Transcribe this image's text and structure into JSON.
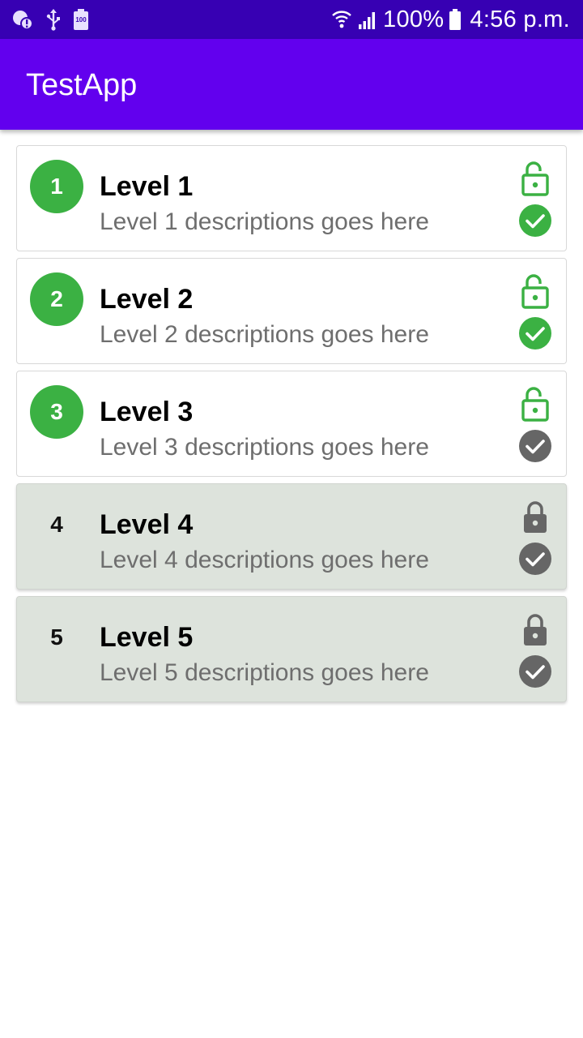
{
  "status_bar": {
    "battery_percent": "100%",
    "time": "4:56 p.m.",
    "left_icons": [
      "notification-alert-icon",
      "usb-icon",
      "battery-saver-100-icon"
    ],
    "right_icons": [
      "wifi-icon",
      "cellular-signal-icon",
      "battery-icon"
    ],
    "battery_icon_text": "100"
  },
  "app_bar": {
    "title": "TestApp"
  },
  "colors": {
    "status_bar": "#3700b3",
    "app_bar": "#6200ee",
    "unlocked_green": "#3bb143",
    "locked_gray": "#666666",
    "locked_card_bg": "#dde3dc"
  },
  "levels": [
    {
      "number": "1",
      "title": "Level 1",
      "description": "Level 1 descriptions goes here",
      "unlocked": true,
      "completed": true
    },
    {
      "number": "2",
      "title": "Level 2",
      "description": "Level 2 descriptions goes here",
      "unlocked": true,
      "completed": true
    },
    {
      "number": "3",
      "title": "Level 3",
      "description": "Level 3 descriptions goes here",
      "unlocked": true,
      "completed": false
    },
    {
      "number": "4",
      "title": "Level 4",
      "description": "Level 4 descriptions goes here",
      "unlocked": false,
      "completed": false
    },
    {
      "number": "5",
      "title": "Level 5",
      "description": "Level 5 descriptions goes here",
      "unlocked": false,
      "completed": false
    }
  ]
}
